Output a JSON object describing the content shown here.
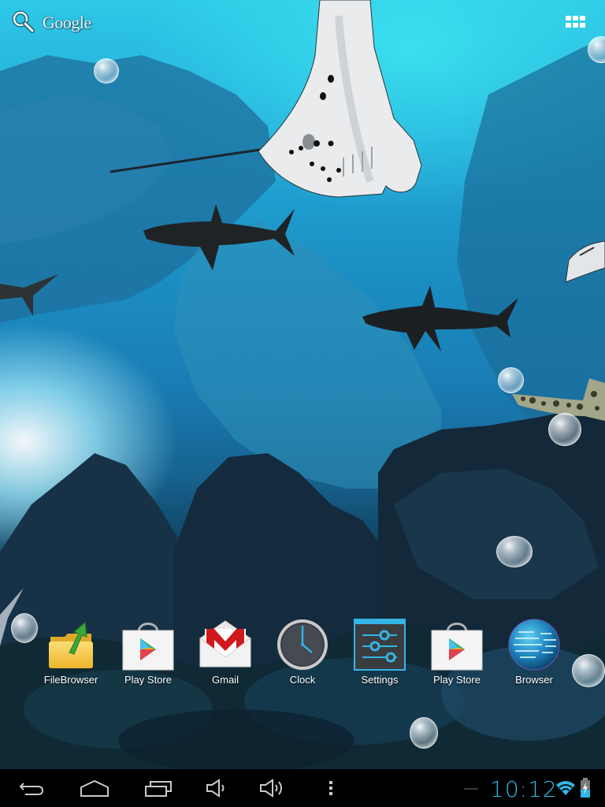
{
  "search": {
    "label": "Google",
    "icon": "search-icon"
  },
  "all_apps": {
    "icon": "apps-grid-icon"
  },
  "wallpaper": {
    "theme": "underwater live wallpaper",
    "creatures": [
      "manta-ray",
      "shark",
      "shark",
      "shark",
      "manta-ray",
      "leopard-shark",
      "fish"
    ]
  },
  "dock": {
    "apps": [
      {
        "label": "FileBrowser",
        "icon": "file-browser-icon"
      },
      {
        "label": "Play Store",
        "icon": "play-store-icon"
      },
      {
        "label": "Gmail",
        "icon": "gmail-icon"
      },
      {
        "label": "Clock",
        "icon": "clock-icon"
      },
      {
        "label": "Settings",
        "icon": "settings-icon"
      },
      {
        "label": "Play Store",
        "icon": "play-store-icon"
      },
      {
        "label": "Browser",
        "icon": "browser-icon"
      }
    ]
  },
  "navbar": {
    "buttons": [
      "back",
      "home",
      "recent-apps",
      "volume-down",
      "volume-up",
      "menu"
    ],
    "time": "10:12",
    "accent_color": "#33b5e5",
    "wifi": "connected",
    "battery": "charging"
  }
}
